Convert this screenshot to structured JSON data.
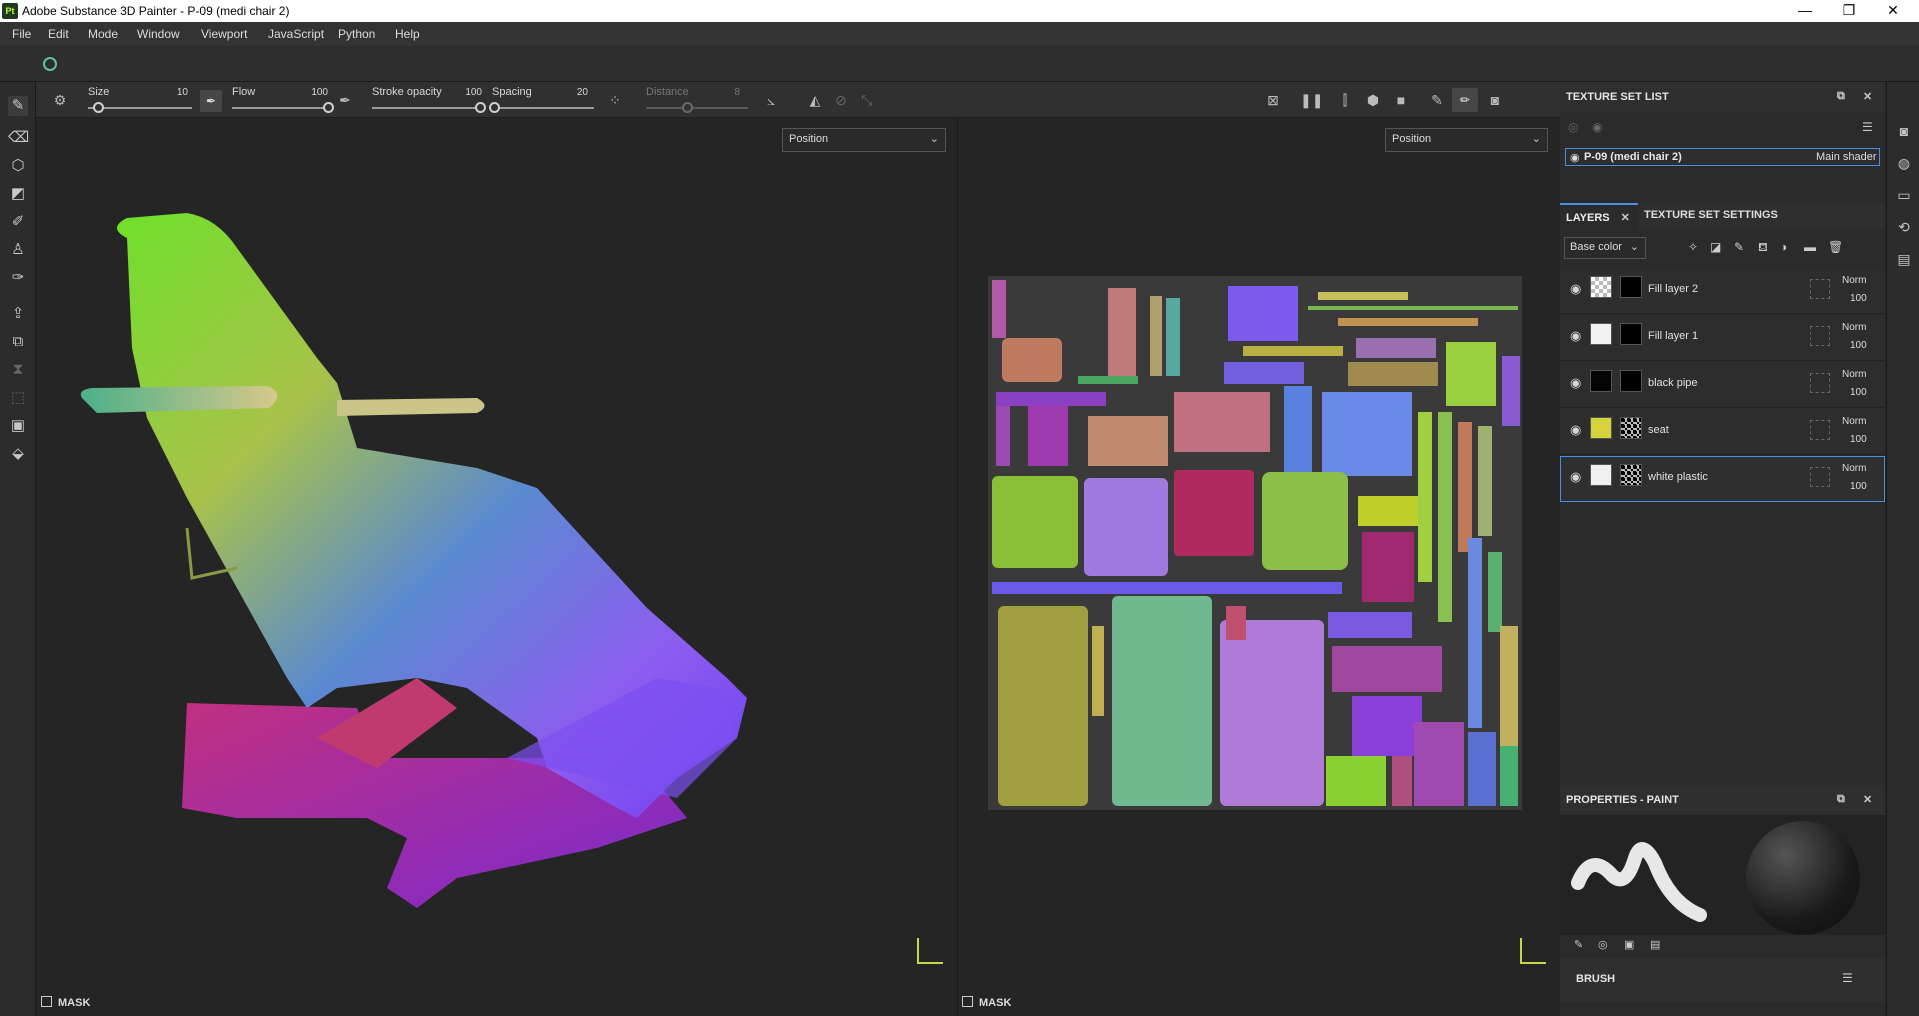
{
  "titlebar": {
    "logo": "Pt",
    "title": "Adobe Substance 3D Painter - P-09 (medi chair 2)",
    "minimize": "—",
    "maximize": "❐",
    "close": "✕"
  },
  "menu": [
    "File",
    "Edit",
    "Mode",
    "Window",
    "Viewport",
    "JavaScript",
    "Python",
    "Help"
  ],
  "tool_options": {
    "size": {
      "label": "Size",
      "value": "10",
      "level": 0.1
    },
    "flow": {
      "label": "Flow",
      "value": "100",
      "level": 1.0
    },
    "stroke_opacity": {
      "label": "Stroke opacity",
      "value": "100",
      "level": 1.0
    },
    "spacing": {
      "label": "Spacing",
      "value": "20",
      "level": 0.02
    },
    "distance": {
      "label": "Distance",
      "value": "8",
      "level": 0.4
    }
  },
  "viewport3d": {
    "channel": "Position",
    "mask_label": "MASK"
  },
  "viewport2d": {
    "channel": "Position",
    "mask_label": "MASK"
  },
  "texture_set_list": {
    "title": "TEXTURE SET LIST",
    "item_name": "P-09 (medi chair 2)",
    "item_shader": "Main shader"
  },
  "layers_panel": {
    "tabs": [
      "LAYERS",
      "TEXTURE SET SETTINGS"
    ],
    "channel": "Base color",
    "layers": [
      {
        "name": "Fill layer 2",
        "blend": "Norm",
        "opacity": "100"
      },
      {
        "name": "Fill layer 1",
        "blend": "Norm",
        "opacity": "100"
      },
      {
        "name": "black pipe",
        "blend": "Norm",
        "opacity": "100"
      },
      {
        "name": "seat",
        "blend": "Norm",
        "opacity": "100"
      },
      {
        "name": "white plastic",
        "blend": "Norm",
        "opacity": "100"
      }
    ]
  },
  "properties": {
    "title": "PROPERTIES - PAINT",
    "brush_section": "BRUSH"
  },
  "colors": {
    "accent": "#4a90e2",
    "panel": "#2b2b2b",
    "viewport": "#252525"
  }
}
